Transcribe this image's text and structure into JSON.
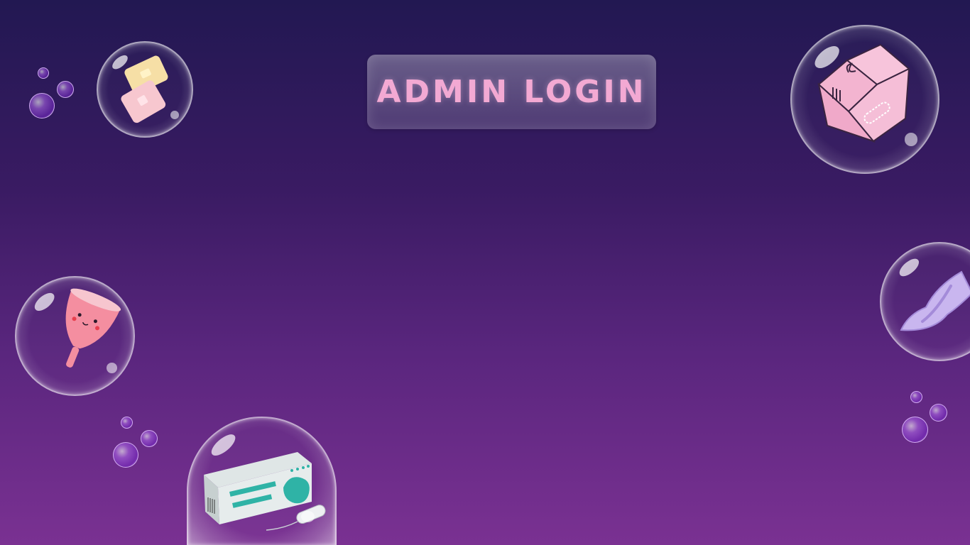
{
  "title": "ADMIN LOGIN",
  "colors": {
    "background_top": "#221852",
    "background_bottom": "#7a3192",
    "title_text": "#f3a9d3"
  },
  "decorations": [
    {
      "name": "pads-bubble",
      "icon": "sanitary-pads-icon"
    },
    {
      "name": "pad-box-bubble",
      "icon": "pad-box-icon"
    },
    {
      "name": "menstrual-cup-bubble",
      "icon": "menstrual-cup-icon"
    },
    {
      "name": "pad-bubble",
      "icon": "sanitary-pad-icon"
    },
    {
      "name": "tampon-box-bubble",
      "icon": "tampon-box-icon"
    }
  ]
}
